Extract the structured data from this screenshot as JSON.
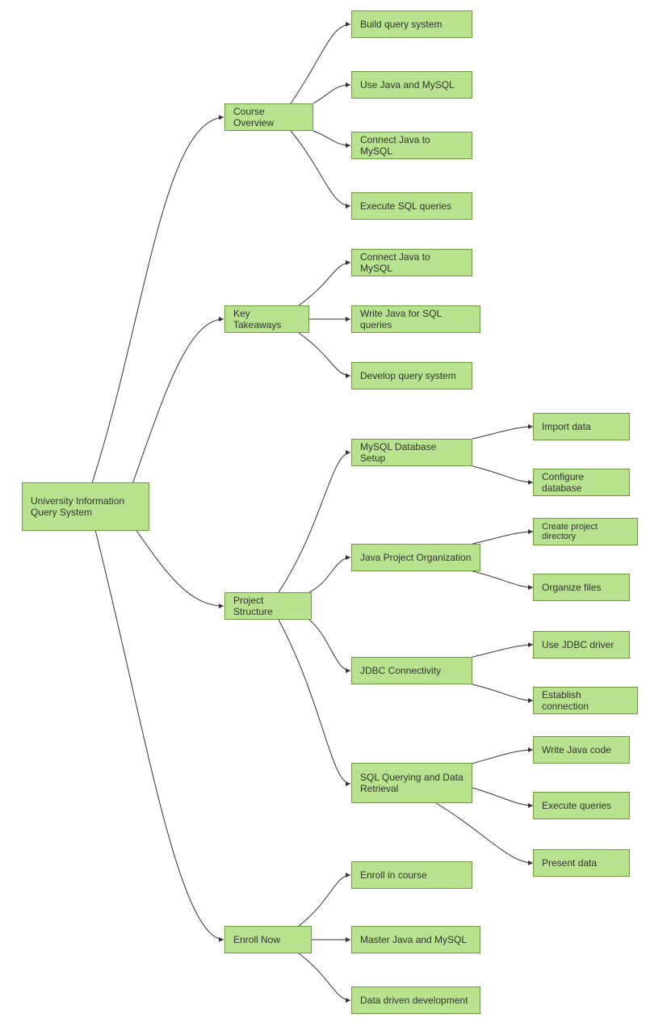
{
  "root": "University Information Query System",
  "branches": {
    "course_overview": {
      "label": "Course Overview",
      "children": [
        "Build query system",
        "Use Java and MySQL",
        "Connect Java to MySQL",
        "Execute SQL queries"
      ]
    },
    "key_takeaways": {
      "label": "Key Takeaways",
      "children": [
        "Connect Java to MySQL",
        "Write Java for SQL queries",
        "Develop query system"
      ]
    },
    "project_structure": {
      "label": "Project Structure",
      "children": {
        "mysql_setup": {
          "label": "MySQL Database Setup",
          "items": [
            "Import data",
            "Configure database"
          ]
        },
        "java_org": {
          "label": "Java Project Organization",
          "items": [
            "Create project directory",
            "Organize files"
          ]
        },
        "jdbc": {
          "label": "JDBC Connectivity",
          "items": [
            "Use JDBC driver",
            "Establish connection"
          ]
        },
        "sql_query": {
          "label": "SQL Querying and Data Retrieval",
          "items": [
            "Write Java code",
            "Execute queries",
            "Present data"
          ]
        }
      }
    },
    "enroll_now": {
      "label": "Enroll Now",
      "children": [
        "Enroll in course",
        "Master Java and MySQL",
        "Data driven development"
      ]
    }
  }
}
